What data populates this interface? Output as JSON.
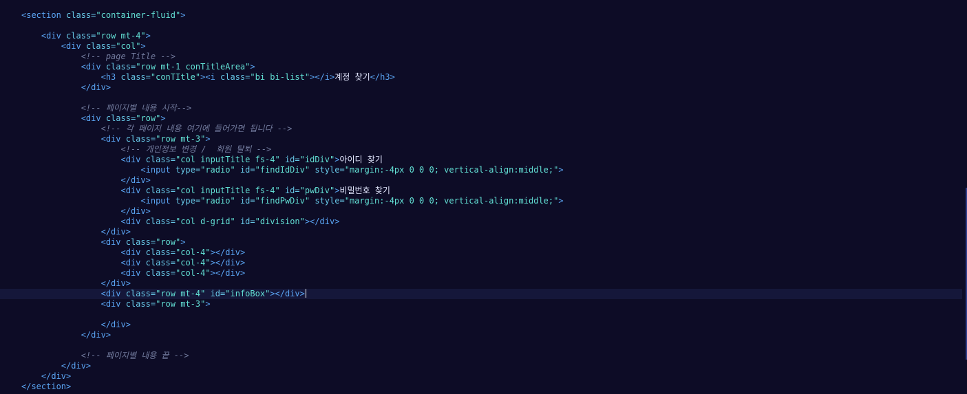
{
  "editor": {
    "lines": [
      "<section class=\"container-fluid\">",
      "",
      "    <div class=\"row mt-4\">",
      "        <div class=\"col\">",
      "            <!-- page Title -->",
      "            <div class=\"row mt-1 conTitleArea\">",
      "                <h3 class=\"conTItle\"><i class=\"bi bi-list\"></i>계정 찾기</h3>",
      "            </div>",
      "",
      "            <!-- 페이지별 내용 시작-->",
      "            <div class=\"row\">",
      "                <!-- 각 페이지 내용 여기에 들어가면 됩니다 -->",
      "                <div class=\"row mt-3\">",
      "                    <!-- 개인정보 변경 /  회원 탈퇴 -->",
      "                    <div class=\"col inputTitle fs-4\" id=\"idDiv\">아이디 찾기",
      "                        <input type=\"radio\" id=\"findIdDiv\" style=\"margin:-4px 0 0 0; vertical-align:middle;\">",
      "                    </div>",
      "                    <div class=\"col inputTitle fs-4\" id=\"pwDiv\">비밀번호 찾기",
      "                        <input type=\"radio\" id=\"findPwDiv\" style=\"margin:-4px 0 0 0; vertical-align:middle;\">",
      "                    </div>",
      "                    <div class=\"col d-grid\" id=\"division\"></div>",
      "                </div>",
      "                <div class=\"row\">",
      "                    <div class=\"col-4\"></div>",
      "                    <div class=\"col-4\"></div>",
      "                    <div class=\"col-4\"></div>",
      "                </div>",
      "                <div class=\"row mt-4\" id=\"infoBox\"></div>",
      "                <div class=\"row mt-3\">",
      "",
      "                </div>",
      "            </div>",
      "",
      "            <!-- 페이지별 내용 끝 -->",
      "        </div>",
      "    </div>",
      "</section>"
    ],
    "cursor": {
      "line": 27,
      "col": 51
    },
    "colors": {
      "background": "#0d0c26",
      "tag": "#5aa4f2",
      "attribute": "#67c7e6",
      "string": "#62dfd4",
      "text": "#e4e8ff",
      "comment": "#717a9c",
      "active_line": "#15173a"
    }
  }
}
